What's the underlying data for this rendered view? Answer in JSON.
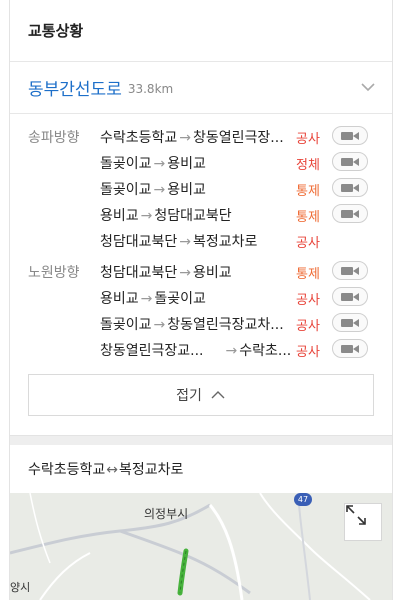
{
  "header": {
    "title": "교통상황"
  },
  "road": {
    "name": "동부간선도로",
    "distance": "33.8km"
  },
  "directions": [
    {
      "label": "송파방향",
      "items": [
        {
          "from": "수락초등학교",
          "to": "창동열린극장...",
          "status": "공사",
          "status_color": "#e8443a",
          "has_cctv": true
        },
        {
          "from": "돌곶이교",
          "to": "용비교",
          "status": "정체",
          "status_color": "#e8443a",
          "has_cctv": true
        },
        {
          "from": "돌곶이교",
          "to": "용비교",
          "status": "통제",
          "status_color": "#ef6a33",
          "has_cctv": true
        },
        {
          "from": "용비교",
          "to": "청담대교북단",
          "status": "통제",
          "status_color": "#ef6a33",
          "has_cctv": true
        },
        {
          "from": "청담대교북단",
          "to": "복정교차로",
          "status": "공사",
          "status_color": "#e8443a",
          "has_cctv": false
        }
      ]
    },
    {
      "label": "노원방향",
      "items": [
        {
          "from": "청담대교북단",
          "to": "용비교",
          "status": "통제",
          "status_color": "#ef6a33",
          "has_cctv": true
        },
        {
          "from": "용비교",
          "to": "돌곶이교",
          "status": "공사",
          "status_color": "#e8443a",
          "has_cctv": true
        },
        {
          "from": "돌곶이교",
          "to": "창동열린극장교차...",
          "status": "공사",
          "status_color": "#e8443a",
          "has_cctv": true
        },
        {
          "from": "창동열린극장교...",
          "to": "수락초...",
          "status": "공사",
          "status_color": "#e8443a",
          "has_cctv": true
        }
      ]
    }
  ],
  "fold": {
    "label": "접기"
  },
  "map": {
    "route_from": "수락초등학교",
    "route_to": "복정교차로",
    "city_label": "의정부시",
    "city_label_2": "양시",
    "road_badge": "47"
  },
  "colors": {
    "accent": "#1d6fc9",
    "status_red": "#e8443a",
    "status_orange": "#ef6a33",
    "route_green": "#46b23c"
  },
  "icons": [
    "chevron-down-icon",
    "cctv-camera-icon",
    "chevron-up-icon",
    "expand-icon"
  ]
}
